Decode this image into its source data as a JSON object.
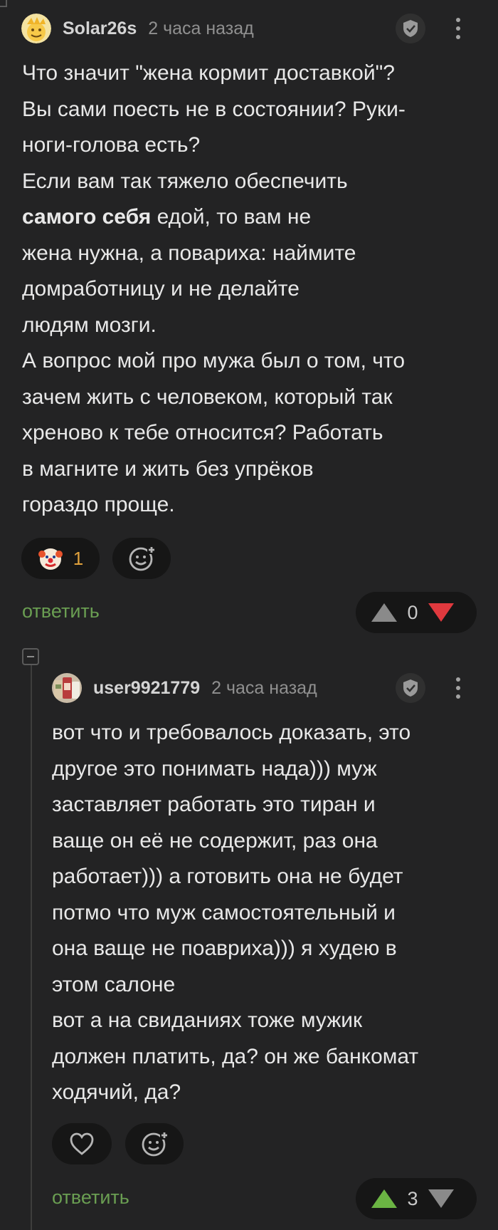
{
  "comment1": {
    "author": "Solar26s",
    "time": "2 часа назад",
    "lines": [
      "Что значит \"жена кормит доставкой\"?",
      "Вы сами поесть не в состоянии? Руки-",
      "ноги-голова есть?",
      "Если вам так тяжело обеспечить",
      "самого себя",
      " едой, то вам не",
      "жена нужна, а повариха: наймите",
      "домработницу и не делайте",
      "людям мозги.",
      "А вопрос мой про мужа был о том, что",
      "зачем жить с человеком, который так",
      "хреново к тебе относится? Работать",
      "в магните и жить без упрёков",
      "гораздо проще."
    ],
    "reaction_icon": "clown-face-emoji",
    "reaction_count": "1",
    "add_reaction_icon": "add-emoji-icon",
    "reply_label": "ответить",
    "rating": "0",
    "colors": {
      "upvote": "#8a8a8a",
      "downvote": "#e0393e"
    }
  },
  "comment2": {
    "author": "user9921779",
    "time": "2 часа назад",
    "lines": [
      "вот что и требовалось доказать, это",
      "другое это понимать нада))) муж",
      "заставляет работать это тиран и",
      "ваще он её не содержит, раз она",
      "работает))) а готовить она не будет",
      "потмо что муж самостоятельный и",
      "она ваще не поавриха))) я худею в",
      "этом салоне",
      "вот а на свиданиях тоже мужик",
      "должен платить, да? он же банкомат",
      "ходячий, да?"
    ],
    "like_icon": "heart-icon",
    "add_reaction_icon": "add-emoji-icon",
    "reply_label": "ответить",
    "rating": "3",
    "colors": {
      "upvote": "#6bb443",
      "downvote": "#8a8a8a"
    }
  },
  "theme": {
    "background": "#232324",
    "pill": "#161616",
    "reply": "#6a9e52"
  }
}
